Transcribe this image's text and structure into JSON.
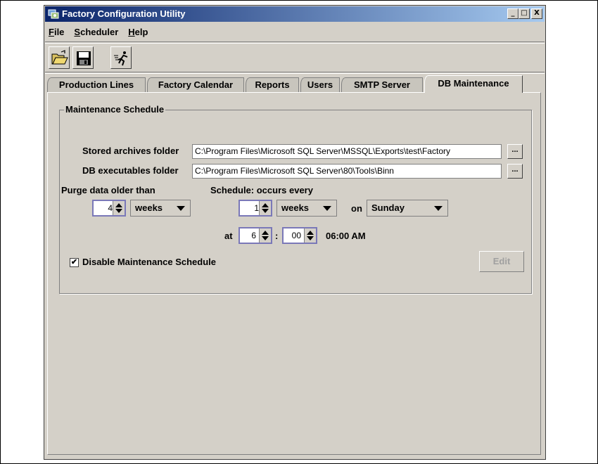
{
  "window": {
    "title": "Factory Configuration Utility",
    "controls": {
      "minimize": "_",
      "maximize": "□",
      "close": "X"
    }
  },
  "menu": {
    "file": "File",
    "scheduler": "Scheduler",
    "help": "Help"
  },
  "toolbar": {
    "open": "folder-open-icon",
    "save": "floppy-disk-icon",
    "run": "running-man-icon"
  },
  "tabs": [
    {
      "label": "Production Lines"
    },
    {
      "label": "Factory Calendar"
    },
    {
      "label": "Reports"
    },
    {
      "label": "Users"
    },
    {
      "label": "SMTP Server"
    },
    {
      "label": "DB Maintenance",
      "active": true
    }
  ],
  "maintenance": {
    "group_title": "Maintenance Schedule",
    "archives_label": "Stored archives folder",
    "archives_value": "C:\\Program Files\\Microsoft SQL Server\\MSSQL\\Exports\\test\\Factory",
    "executables_label": "DB executables folder",
    "executables_value": "C:\\Program Files\\Microsoft SQL Server\\80\\Tools\\Binn",
    "browse_label": "...",
    "purge_label": "Purge data older than",
    "purge_value": "4",
    "purge_unit": "weeks",
    "schedule_label": "Schedule:  occurs every",
    "schedule_value": "1",
    "schedule_unit": "weeks",
    "on_label": "on",
    "day": "Sunday",
    "at_label": "at",
    "hour": "6",
    "colon": ":",
    "minute": "00",
    "time_display": "06:00 AM",
    "disable_label": "Disable Maintenance Schedule",
    "disable_checked": true,
    "edit_label": "Edit"
  },
  "colors": {
    "titlebar_start": "#0a246a",
    "titlebar_end": "#a6caf0",
    "panel": "#d4d0c8",
    "spinner_border": "#7a78b8"
  }
}
